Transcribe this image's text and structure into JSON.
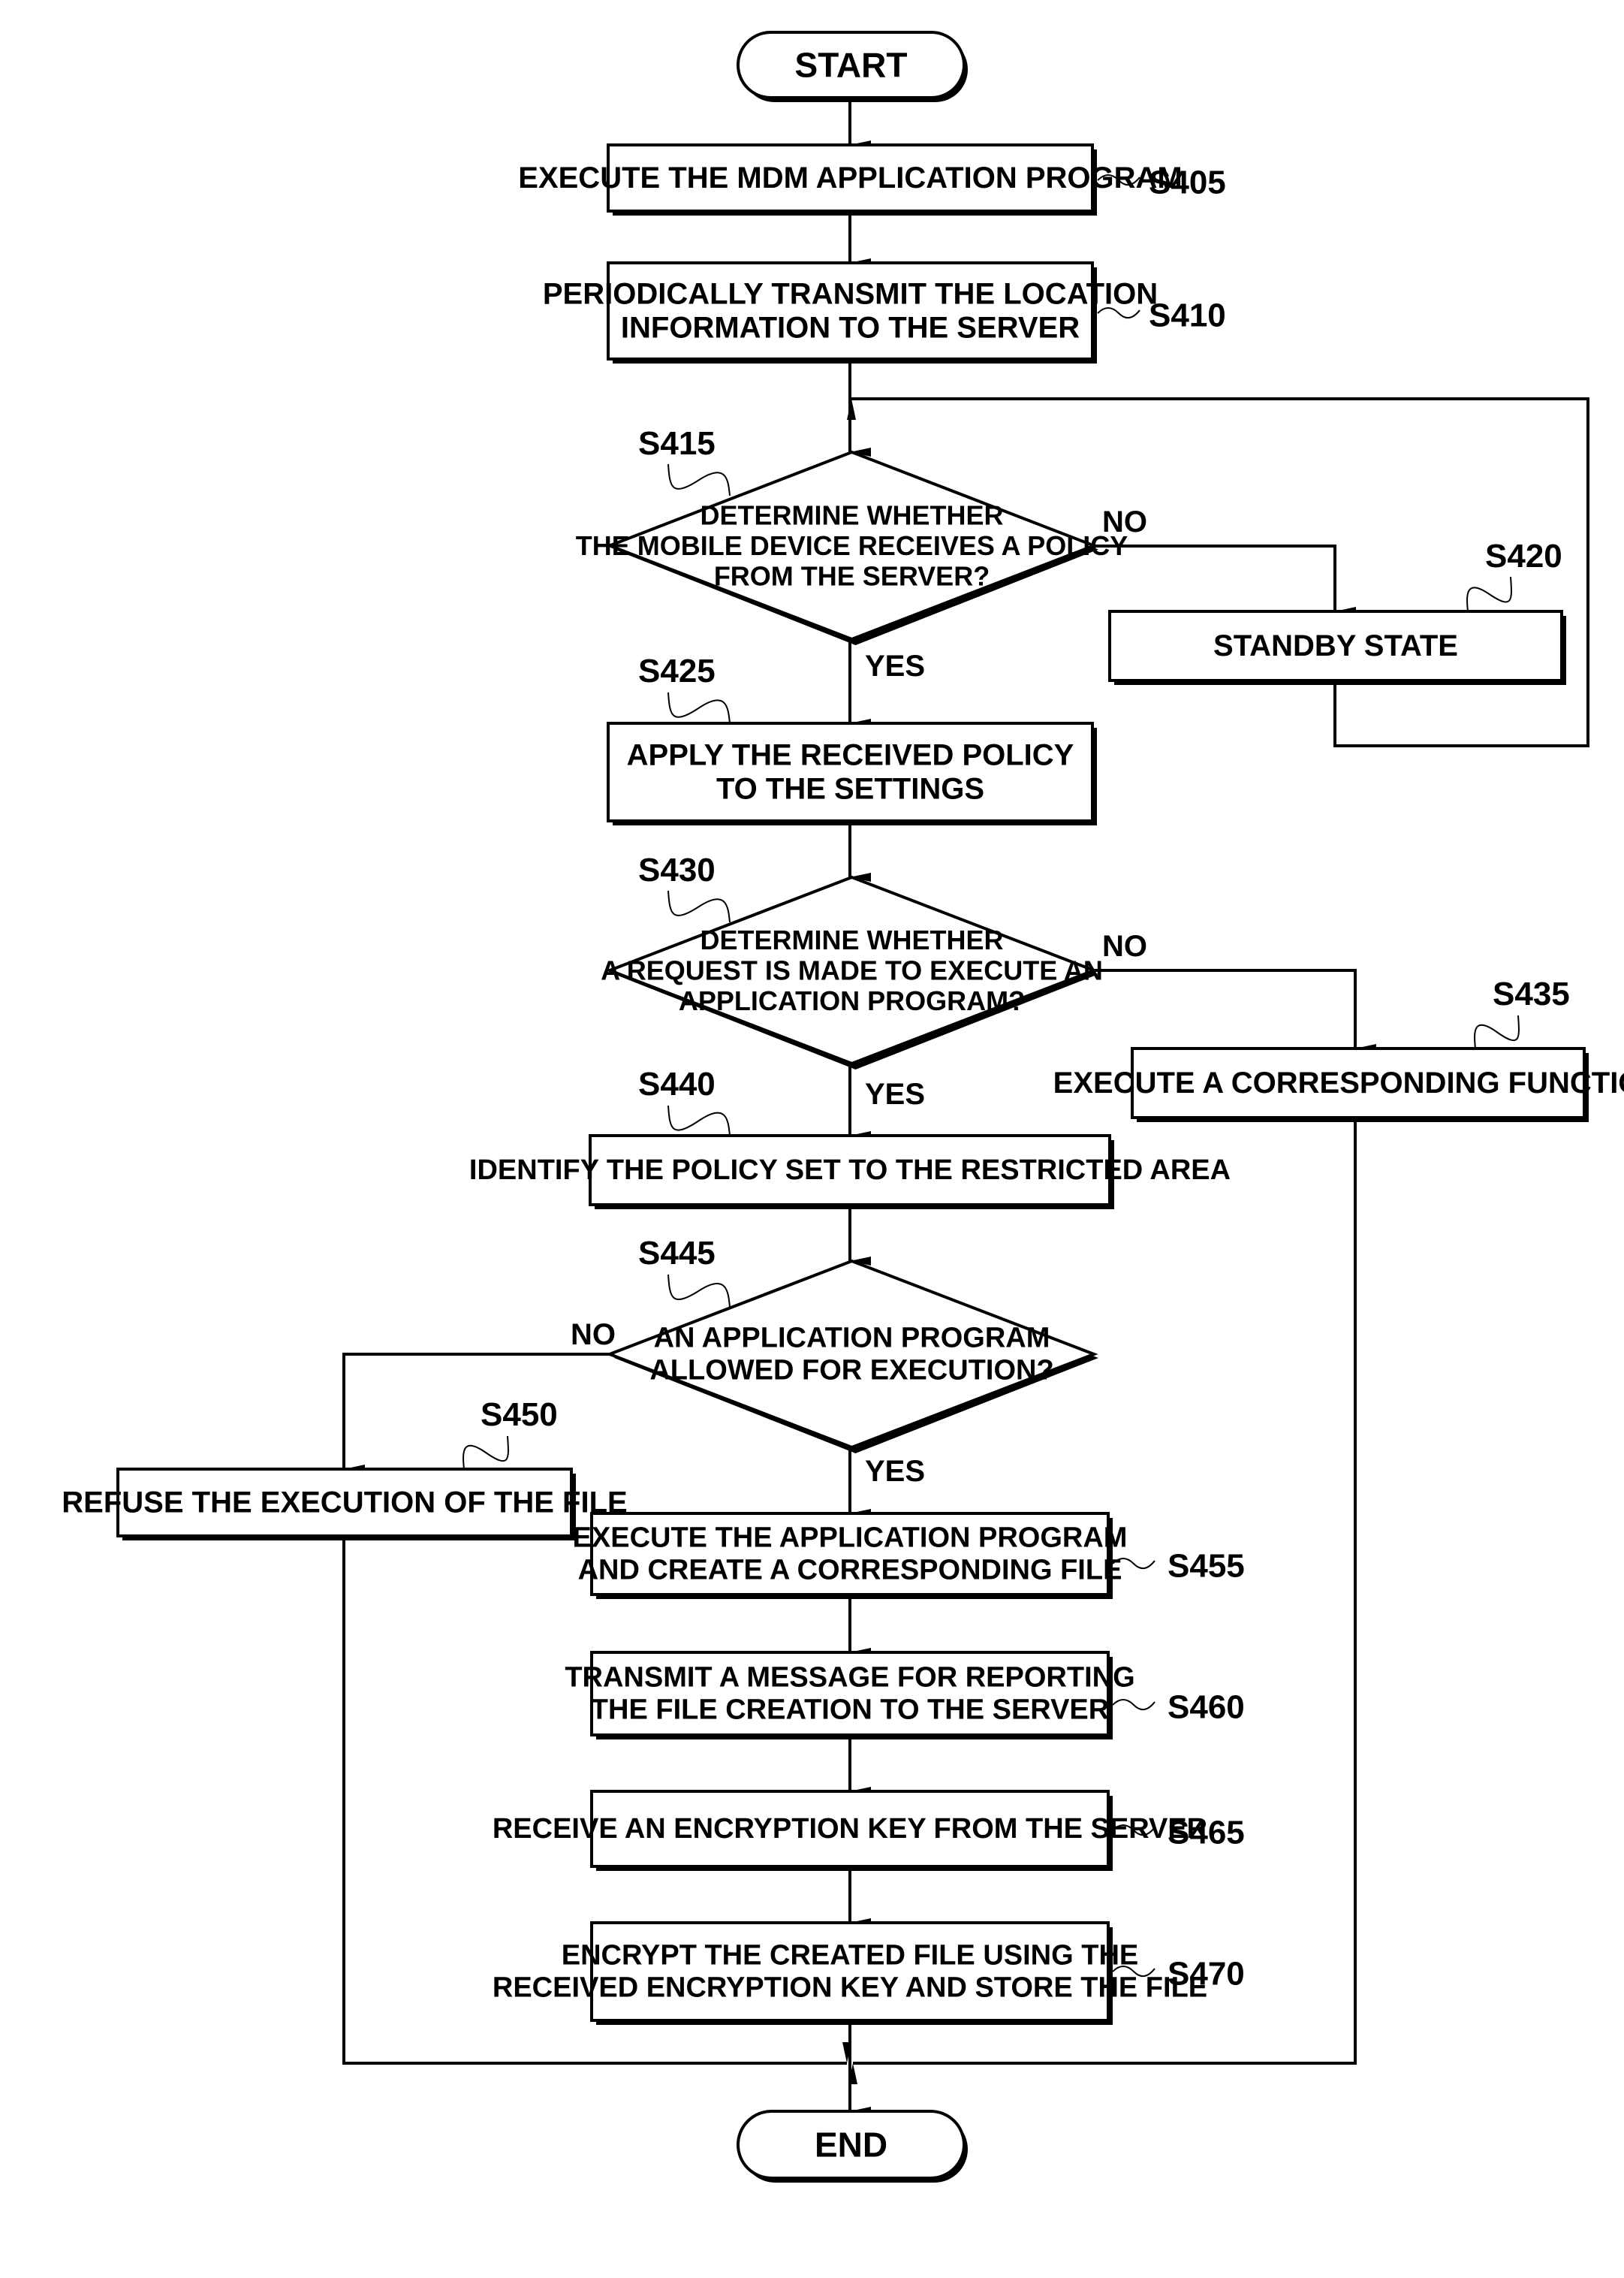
{
  "figure": {
    "type": "flowchart",
    "colors": {
      "stroke": "#000000",
      "background": "#ffffff"
    }
  },
  "terminals": {
    "start": "START",
    "end": "END"
  },
  "steps": {
    "s405": {
      "id": "S405",
      "lines": [
        "EXECUTE THE MDM APPLICATION PROGRAM"
      ]
    },
    "s410": {
      "id": "S410",
      "lines": [
        "PERIODICALLY TRANSMIT THE LOCATION",
        "INFORMATION TO THE SERVER"
      ]
    },
    "s415": {
      "id": "S415",
      "lines": [
        "DETERMINE WHETHER",
        "THE MOBILE DEVICE RECEIVES A POLICY",
        "FROM THE SERVER?"
      ]
    },
    "s420": {
      "id": "S420",
      "lines": [
        "STANDBY STATE"
      ]
    },
    "s425": {
      "id": "S425",
      "lines": [
        "APPLY THE RECEIVED POLICY",
        "TO THE SETTINGS"
      ]
    },
    "s430": {
      "id": "S430",
      "lines": [
        "DETERMINE WHETHER",
        "A REQUEST IS MADE TO EXECUTE AN",
        "APPLICATION PROGRAM?"
      ]
    },
    "s435": {
      "id": "S435",
      "lines": [
        "EXECUTE A CORRESPONDING FUNCTION"
      ]
    },
    "s440": {
      "id": "S440",
      "lines": [
        "IDENTIFY THE POLICY SET TO THE RESTRICTED AREA"
      ]
    },
    "s445": {
      "id": "S445",
      "lines": [
        "AN APPLICATION PROGRAM",
        "ALLOWED FOR EXECUTION?"
      ]
    },
    "s450": {
      "id": "S450",
      "lines": [
        "REFUSE THE EXECUTION OF THE FILE"
      ]
    },
    "s455": {
      "id": "S455",
      "lines": [
        "EXECUTE THE APPLICATION PROGRAM",
        "AND CREATE A CORRESPONDING FILE"
      ]
    },
    "s460": {
      "id": "S460",
      "lines": [
        "TRANSMIT A MESSAGE FOR REPORTING",
        "THE FILE CREATION TO THE SERVER"
      ]
    },
    "s465": {
      "id": "S465",
      "lines": [
        "RECEIVE AN ENCRYPTION KEY FROM THE SERVER"
      ]
    },
    "s470": {
      "id": "S470",
      "lines": [
        "ENCRYPT THE CREATED FILE USING THE",
        "RECEIVED ENCRYPTION KEY AND STORE THE FILE"
      ]
    }
  },
  "branches": {
    "s415_no": "NO",
    "s415_yes": "YES",
    "s430_no": "NO",
    "s430_yes": "YES",
    "s445_no": "NO",
    "s445_yes": "YES"
  }
}
